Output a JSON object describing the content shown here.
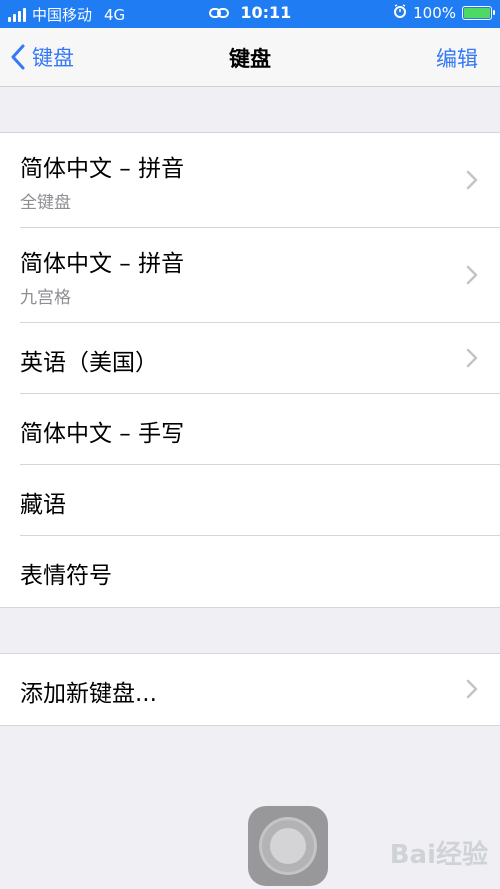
{
  "status_bar": {
    "carrier": "中国移动",
    "network": "4G",
    "time": "10:11",
    "battery": "100%",
    "icons": [
      "signal-icon",
      "link-icon",
      "alarm-icon",
      "battery-icon"
    ]
  },
  "nav": {
    "back_label": "键盘",
    "title": "键盘",
    "edit_label": "编辑"
  },
  "keyboards": [
    {
      "name": "简体中文 – 拼音",
      "detail": "全键盘"
    },
    {
      "name": "简体中文 – 拼音",
      "detail": "九宫格"
    },
    {
      "name": "英语（美国）"
    },
    {
      "name": "简体中文 – 手写"
    },
    {
      "name": "藏语"
    },
    {
      "name": "表情符号"
    }
  ],
  "add_keyboard": "添加新键盘...",
  "watermark": "Bai经验",
  "colors": {
    "status_bar": "#1f7cf3",
    "accent": "#3478f6",
    "background": "#efeff4"
  }
}
